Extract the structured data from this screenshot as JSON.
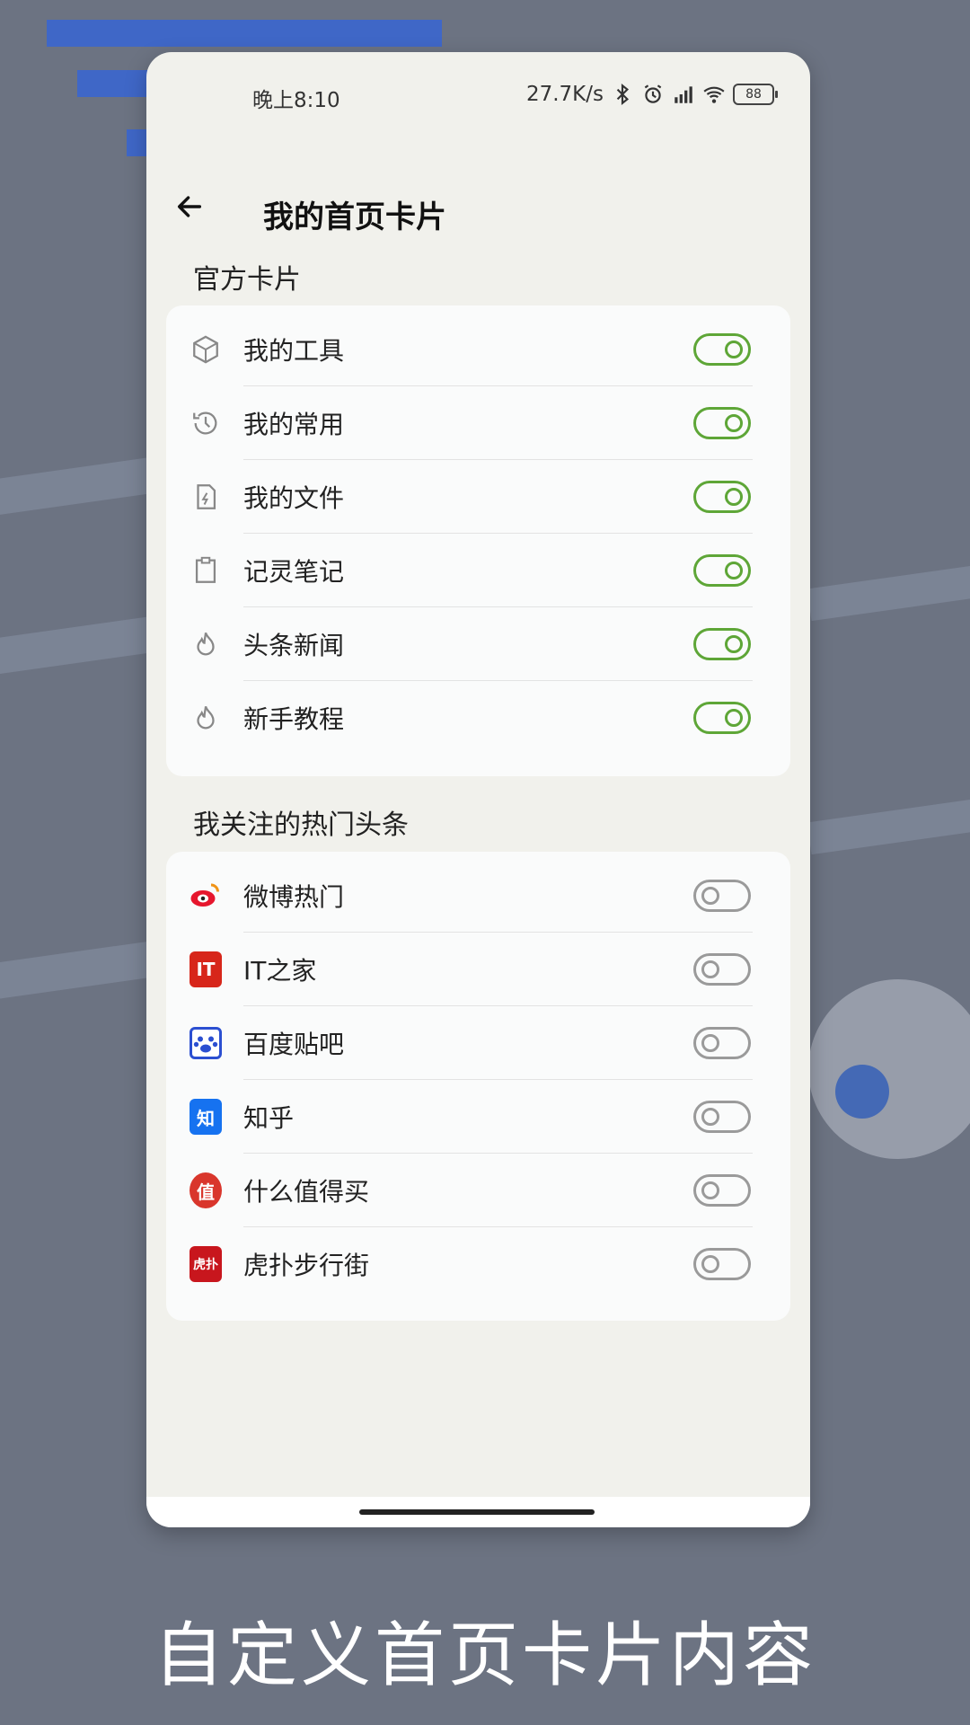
{
  "status_bar": {
    "time": "晚上8:10",
    "speed": "27.7K/s",
    "battery": "88"
  },
  "header": {
    "title": "我的首页卡片"
  },
  "sections": {
    "official": {
      "title": "官方卡片",
      "items": [
        {
          "label": "我的工具",
          "icon": "cube-icon",
          "on": true
        },
        {
          "label": "我的常用",
          "icon": "history-icon",
          "on": true
        },
        {
          "label": "我的文件",
          "icon": "file-icon",
          "on": true
        },
        {
          "label": "记灵笔记",
          "icon": "clipboard-icon",
          "on": true
        },
        {
          "label": "头条新闻",
          "icon": "flame-icon",
          "on": true
        },
        {
          "label": "新手教程",
          "icon": "flame-icon",
          "on": true
        }
      ]
    },
    "hot": {
      "title": "我关注的热门头条",
      "items": [
        {
          "label": "微博热门",
          "icon": "weibo-icon",
          "on": false
        },
        {
          "label": "IT之家",
          "icon": "ithome-icon",
          "brand_text": "IT",
          "on": false
        },
        {
          "label": "百度贴吧",
          "icon": "baidu-tieba-icon",
          "on": false
        },
        {
          "label": "知乎",
          "icon": "zhihu-icon",
          "brand_text": "知",
          "on": false
        },
        {
          "label": "什么值得买",
          "icon": "smzdm-icon",
          "brand_text": "值",
          "on": false
        },
        {
          "label": "虎扑步行街",
          "icon": "hupu-icon",
          "brand_text": "虎扑",
          "on": false
        }
      ]
    }
  },
  "caption": "自定义首页卡片内容",
  "colors": {
    "toggle_on": "#5ea637",
    "toggle_off": "#9a9a9a"
  }
}
